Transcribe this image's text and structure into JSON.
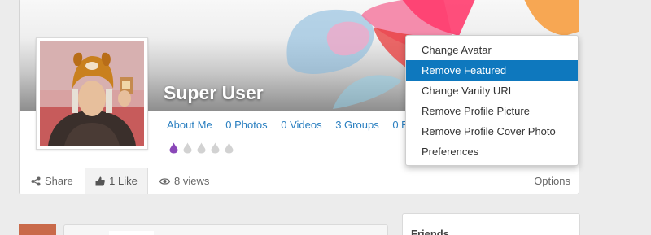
{
  "profile": {
    "name": "Super User",
    "links": [
      "About Me",
      "0 Photos",
      "0 Videos",
      "3 Groups",
      "0 E"
    ],
    "rating": {
      "filled": 1,
      "total": 5
    }
  },
  "actions": {
    "share": "Share",
    "like": "1 Like",
    "views": "8 views",
    "options": "Options"
  },
  "options_menu": {
    "items": [
      "Change Avatar",
      "Remove Featured",
      "Change Vanity URL",
      "Remove Profile Picture",
      "Remove Profile Cover Photo",
      "Preferences"
    ],
    "highlighted": "Remove Featured"
  },
  "sidebar": {
    "friends_title": "Friends"
  },
  "colors": {
    "link": "#2a7fc0",
    "menu_highlight": "#0e78be",
    "rating_filled": "#8a47b8",
    "rating_empty": "#d2d2d2"
  }
}
